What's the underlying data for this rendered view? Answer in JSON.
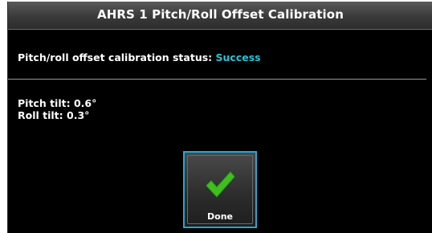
{
  "dialog": {
    "title": "AHRS 1 Pitch/Roll Offset Calibration"
  },
  "calibration": {
    "status_label": "Pitch/roll offset calibration status:",
    "status_value": "Success",
    "status_color": "#22c5d8"
  },
  "tilt": {
    "pitch_text": "Pitch tilt: 0.6°",
    "roll_text": "Roll tilt: 0.3°"
  },
  "done_button": {
    "label": "Done",
    "icon": "checkmark-icon",
    "icon_color": "#3fbf1f",
    "border_color": "#1fa9d6"
  }
}
